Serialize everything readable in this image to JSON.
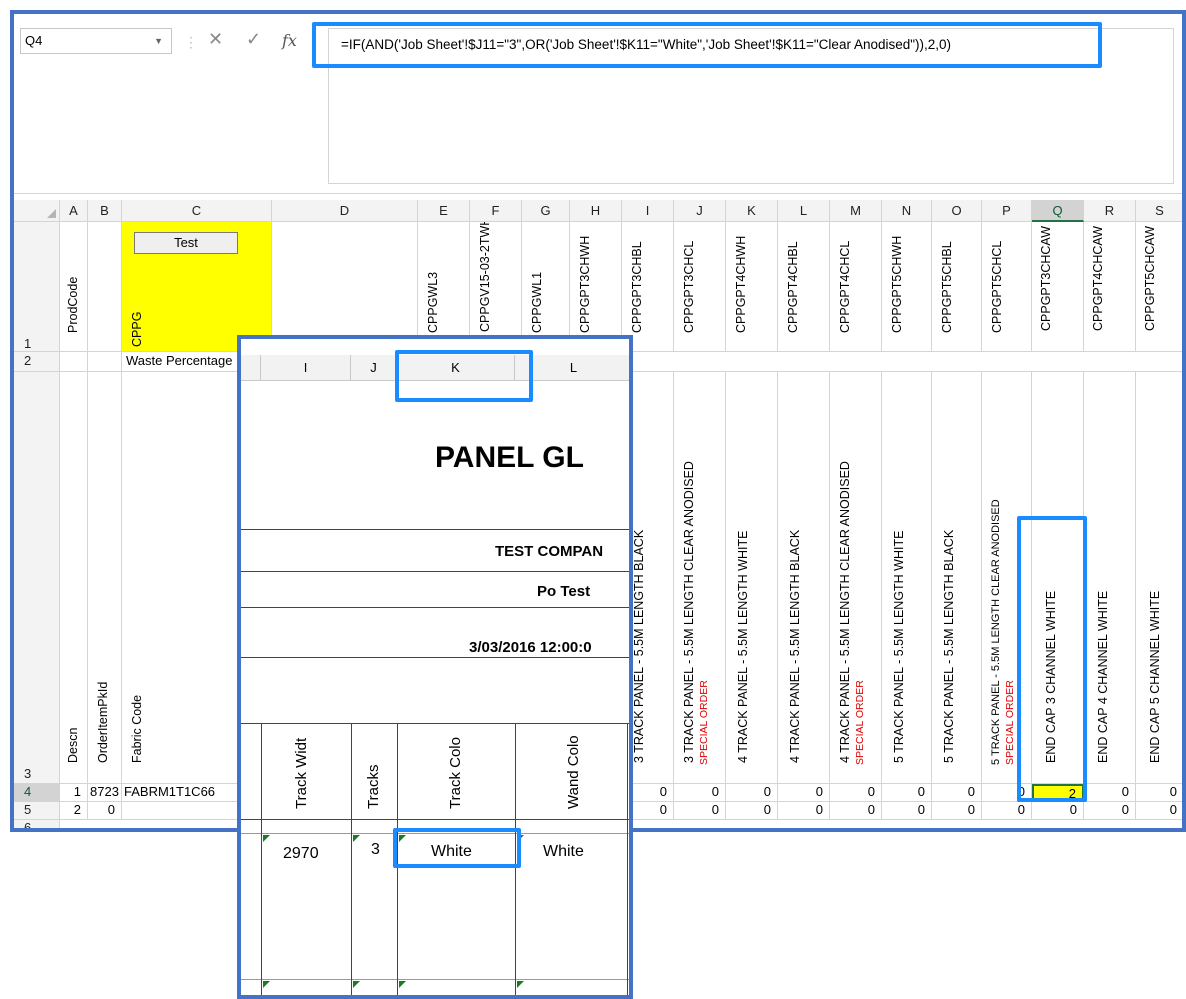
{
  "formula_bar": {
    "name_box": "Q4",
    "cancel_icon": "cancel-icon",
    "enter_icon": "check-icon",
    "fx_label": "fx",
    "formula": "=IF(AND('Job Sheet'!$J11=\"3\",OR('Job Sheet'!$K11=\"White\",'Job Sheet'!$K11=\"Clear Anodised\")),2,0)"
  },
  "columns": [
    "A",
    "B",
    "C",
    "D",
    "E",
    "F",
    "G",
    "H",
    "I",
    "J",
    "K",
    "L",
    "M",
    "N",
    "O",
    "P",
    "Q",
    "R",
    "S"
  ],
  "row_numbers": [
    "1",
    "2",
    "3",
    "4",
    "5",
    "6"
  ],
  "row1": {
    "A": "ProdCode",
    "C": "CPPG",
    "button": "Test",
    "E": "CPPGWL3",
    "F": "CPPGV15-03-2TWH",
    "G": "CPPGWL1",
    "H": "CPPGPT3CHWH",
    "I": "CPPGPT3CHBL",
    "J": "CPPGPT3CHCL",
    "K": "CPPGPT4CHWH",
    "L": "CPPGPT4CHBL",
    "M": "CPPGPT4CHCL",
    "N": "CPPGPT5CHWH",
    "O": "CPPGPT5CHBL",
    "P": "CPPGPT5CHCL",
    "Q": "CPPGPT3CHCAW",
    "R": "CPPGPT4CHCAW",
    "S": "CPPGPT5CHCAW"
  },
  "row2": {
    "C": "Waste Percentage"
  },
  "row3": {
    "A": "Descn",
    "B": "OrderItemPkId",
    "C": "Fabric Code",
    "I": "3 TRACK PANEL - 5.5M LENGTH BLACK",
    "J": "3 TRACK PANEL - 5.5M LENGTH CLEAR ANODISED",
    "K": "4 TRACK PANEL - 5.5M LENGTH WHITE",
    "L": "4 TRACK PANEL - 5.5M LENGTH BLACK",
    "M": "4 TRACK PANEL - 5.5M LENGTH CLEAR ANODISED",
    "N": "5 TRACK PANEL - 5.5M LENGTH WHITE",
    "O": "5 TRACK PANEL - 5.5M LENGTH BLACK",
    "P": "5 TRACK PANEL - 5.5M LENGTH CLEAR ANODISED",
    "Q": "END CAP 3 CHANNEL WHITE",
    "R": "END CAP 4 CHANNEL WHITE",
    "S": "END CAP 5 CHANNEL WHITE",
    "special_order": "SPECIAL ORDER"
  },
  "row4": {
    "A": "1",
    "B": "8723",
    "C": "FABRM1T1C66",
    "I": "0",
    "J": "0",
    "K": "0",
    "L": "0",
    "M": "0",
    "N": "0",
    "O": "0",
    "P": "0",
    "Q": "2",
    "R": "0",
    "S": "0"
  },
  "row5": {
    "A": "2",
    "B": "0",
    "I": "0",
    "J": "0",
    "K": "0",
    "L": "0",
    "M": "0",
    "N": "0",
    "O": "0",
    "P": "0",
    "Q": "0",
    "R": "0",
    "S": "0"
  },
  "job_sheet": {
    "columns": [
      "I",
      "J",
      "K",
      "L"
    ],
    "title": "PANEL GL",
    "company": "TEST COMPAN",
    "po": "Po Test",
    "date": "3/03/2016 12:00:0",
    "headers": [
      "Track Widt",
      "Tracks",
      "Track Colo",
      "Wand Colo"
    ],
    "values": [
      "2970",
      "3",
      "White",
      "White"
    ]
  },
  "colors": {
    "selected_cell": "#ffff00",
    "highlight": "#1a8cff",
    "frame": "#4472c4",
    "special": "#e00000"
  }
}
